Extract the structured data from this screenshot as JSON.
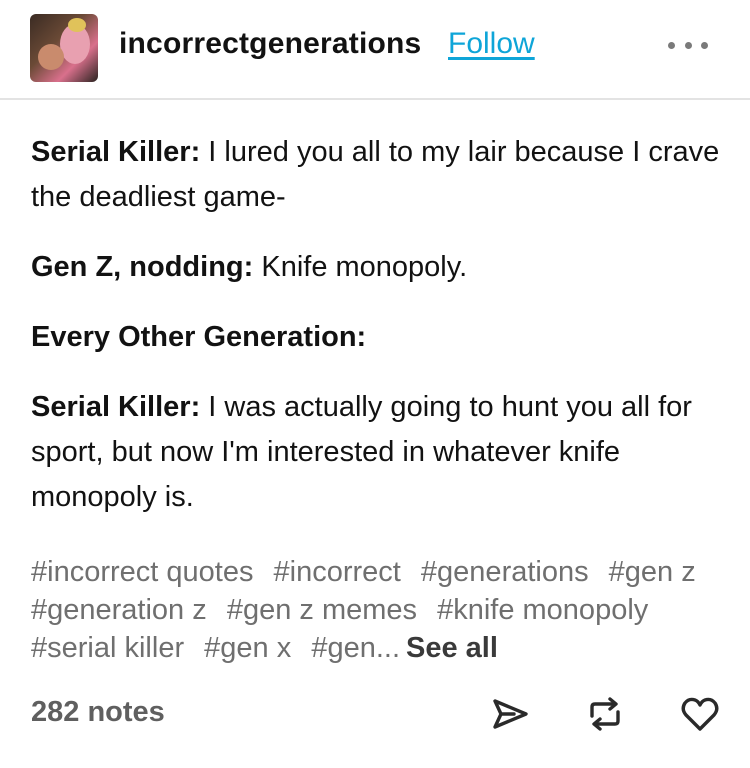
{
  "header": {
    "blog_name": "incorrectgenerations",
    "follow_label": "Follow",
    "more_icon": "more-horizontal-icon"
  },
  "post": {
    "lines": [
      {
        "speaker": "Serial Killer:",
        "text": " I lured you all to my lair because I crave the deadliest game-"
      },
      {
        "speaker": "Gen Z, nodding:",
        "text": " Knife monopoly."
      },
      {
        "speaker": "Every Other Generation:",
        "text": ""
      },
      {
        "speaker": "Serial Killer:",
        "text": " I was actually going to hunt you all for sport, but now I'm interested in whatever knife monopoly is."
      }
    ]
  },
  "tags": {
    "items": [
      "#incorrect quotes",
      "#incorrect",
      "#generations",
      "#gen z",
      "#generation z",
      "#gen z memes",
      "#knife monopoly",
      "#serial killer",
      "#gen x",
      "#gen..."
    ],
    "see_all_label": "See all"
  },
  "footer": {
    "notes": "282 notes",
    "icons": [
      "share-icon",
      "reblog-icon",
      "like-heart-icon"
    ]
  },
  "colors": {
    "accent": "#0ea5d8",
    "text": "#121212",
    "muted": "#6f6f6f",
    "divider": "#e3e3e3"
  }
}
